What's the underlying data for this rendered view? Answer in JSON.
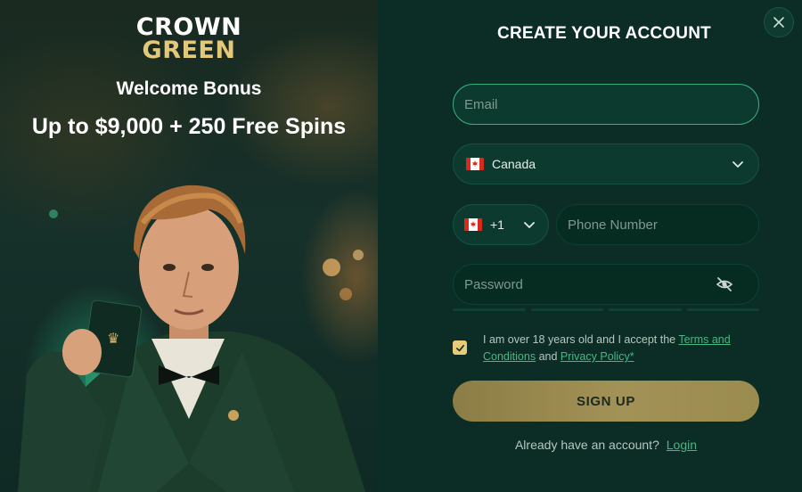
{
  "promo": {
    "logo_line1": "CROWN",
    "logo_line2": "GREEN",
    "bonus_title": "Welcome Bonus",
    "bonus_offer": "Up to $9,000 + 250 Free Spins"
  },
  "form": {
    "title": "CREATE YOUR ACCOUNT",
    "close_icon": "close-icon",
    "email": {
      "placeholder": "Email",
      "value": ""
    },
    "country": {
      "selected": "Canada",
      "flag": "canada-flag-icon"
    },
    "dial_code": {
      "selected": "+1",
      "flag": "canada-flag-icon"
    },
    "phone": {
      "placeholder": "Phone Number",
      "value": ""
    },
    "password": {
      "placeholder": "Password",
      "value": "",
      "toggle_icon": "eye-off-icon"
    },
    "consent": {
      "checked": true,
      "text_before": "I am over 18 years old and I accept the",
      "terms_link": "Terms and Conditions",
      "and": "and",
      "privacy_link": "Privacy Policy*"
    },
    "signup_label": "SIGN UP",
    "login_prompt": "Already have an account?",
    "login_link": "Login"
  },
  "colors": {
    "accent_green": "#45b884",
    "gold": "#e4c87a",
    "panel_bg": "#0b2d25",
    "button_gold": "#a39257"
  }
}
